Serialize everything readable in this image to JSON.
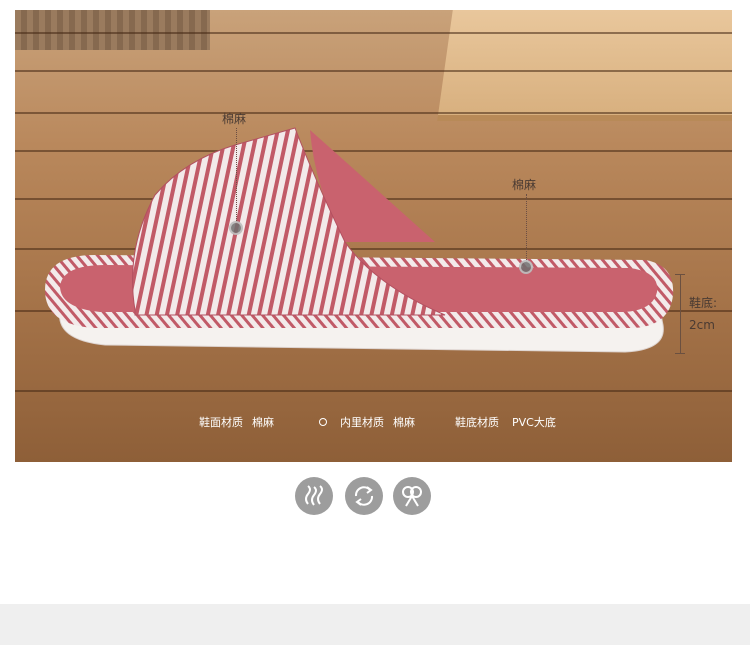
{
  "callouts": {
    "upper_material": "棉麻",
    "insole_material": "棉麻",
    "sole_height_label": "鞋底:",
    "sole_height_value": "2cm"
  },
  "specs": [
    {
      "label": "鞋面材质",
      "value": "棉麻"
    },
    {
      "label": "内里材质",
      "value": "棉麻"
    },
    {
      "label": "鞋底材质",
      "value": "PVC大底"
    }
  ],
  "feature_icons": [
    "breathable-icon",
    "recycle-icon",
    "comfort-knot-icon"
  ],
  "colors": {
    "slipper_red": "#c9626e",
    "stripe_white": "#f3eaea",
    "sole_white": "#f5f2ef",
    "wood": "#a8764b",
    "icon_gray": "#9d9d9d"
  }
}
